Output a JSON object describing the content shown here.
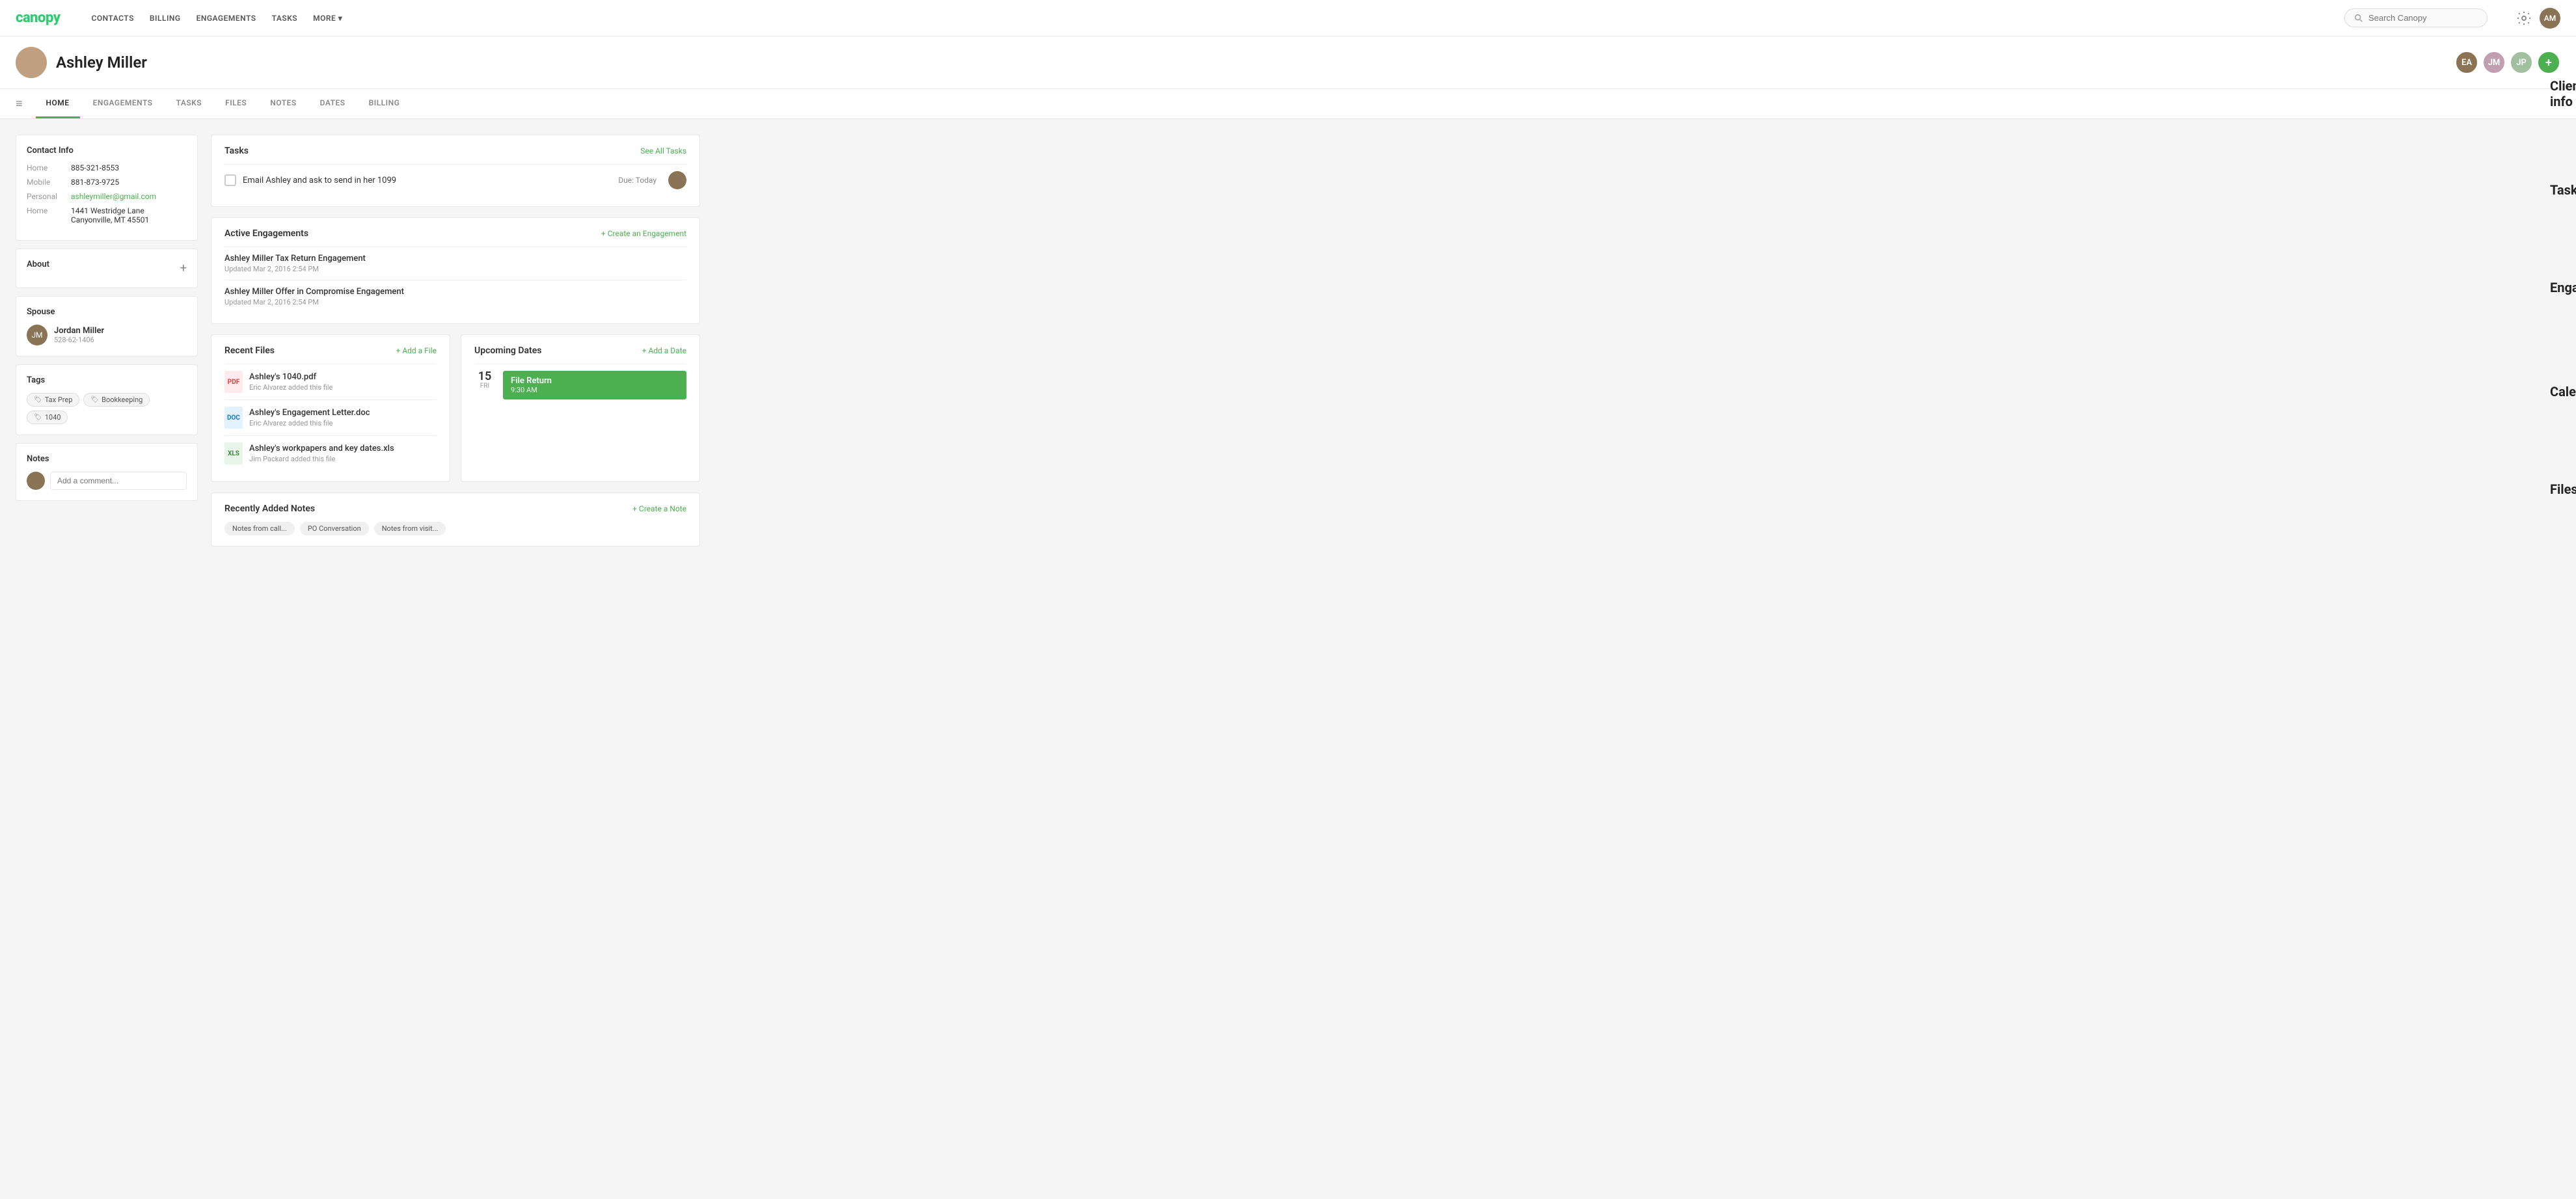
{
  "app": {
    "logo": "canopy"
  },
  "topnav": {
    "links": [
      {
        "label": "CONTACTS",
        "id": "contacts"
      },
      {
        "label": "BILLING",
        "id": "billing"
      },
      {
        "label": "ENGAGEMENTS",
        "id": "engagements"
      },
      {
        "label": "TASKS",
        "id": "tasks"
      },
      {
        "label": "MORE ▾",
        "id": "more"
      }
    ],
    "search_placeholder": "Search Canopy"
  },
  "client": {
    "name": "Ashley Miller",
    "initials": "AM"
  },
  "tabs": [
    {
      "label": "HOME",
      "active": true
    },
    {
      "label": "ENGAGEMENTS"
    },
    {
      "label": "TASKS"
    },
    {
      "label": "FILES"
    },
    {
      "label": "NOTES"
    },
    {
      "label": "DATES"
    },
    {
      "label": "BILLING"
    }
  ],
  "contact_info": {
    "section_title": "Contact Info",
    "rows": [
      {
        "label": "Home",
        "value": "885-321-8553",
        "type": "phone"
      },
      {
        "label": "Mobile",
        "value": "881-873-9725",
        "type": "phone"
      },
      {
        "label": "Personal",
        "value": "ashleymiller@gmail.com",
        "type": "email"
      },
      {
        "label": "Home",
        "value": "1441 Westridge Lane\nCanyonville, MT 45501",
        "type": "address"
      }
    ]
  },
  "about": {
    "section_title": "About"
  },
  "spouse": {
    "section_title": "Spouse",
    "name": "Jordan Miller",
    "phone": "528-62-1406"
  },
  "tags": {
    "section_title": "Tags",
    "items": [
      {
        "label": "Tax Prep",
        "icon": "🏷"
      },
      {
        "label": "Bookkeeping",
        "icon": "🏷"
      },
      {
        "label": "1040",
        "icon": "🏷"
      }
    ]
  },
  "notes": {
    "section_title": "Notes",
    "placeholder": "Add a comment..."
  },
  "tasks": {
    "section_title": "Tasks",
    "action_label": "See All Tasks",
    "items": [
      {
        "text": "Email Ashley and ask to send in her 1099",
        "due": "Due: Today"
      }
    ]
  },
  "engagements": {
    "section_title": "Active Engagements",
    "action_label": "+ Create an Engagement",
    "items": [
      {
        "name": "Ashley Miller Tax Return Engagement",
        "updated": "Updated Mar 2, 2016 2:54 PM"
      },
      {
        "name": "Ashley Miller Offer in Compromise Engagement",
        "updated": "Updated Mar 2, 2016 2:54 PM"
      }
    ]
  },
  "recent_files": {
    "section_title": "Recent Files",
    "action_label": "+ Add a File",
    "items": [
      {
        "name": "Ashley's 1040.pdf",
        "added_by": "Eric Alvarez added this file",
        "type": "pdf"
      },
      {
        "name": "Ashley's Engagement Letter.doc",
        "added_by": "Eric Alvarez added this file",
        "type": "doc"
      },
      {
        "name": "Ashley's workpapers and key dates.xls",
        "added_by": "Jim Packard added this file",
        "type": "xls"
      }
    ]
  },
  "upcoming_dates": {
    "section_title": "Upcoming Dates",
    "action_label": "+ Add a Date",
    "items": [
      {
        "day_num": "15",
        "day_name": "Fri",
        "event_name": "File Return",
        "event_time": "9:30 AM"
      }
    ]
  },
  "recently_added_notes": {
    "section_title": "Recently Added Notes",
    "action_label": "+ Create a Note",
    "note_tabs": [
      {
        "label": "Notes from call..."
      },
      {
        "label": "PO Conversation"
      },
      {
        "label": "Notes from visit..."
      }
    ]
  },
  "annotations": {
    "client_info": "Client info",
    "tasks": "Tasks",
    "engagements": "Engagements",
    "calendar": "Calendar",
    "files": "Files"
  }
}
